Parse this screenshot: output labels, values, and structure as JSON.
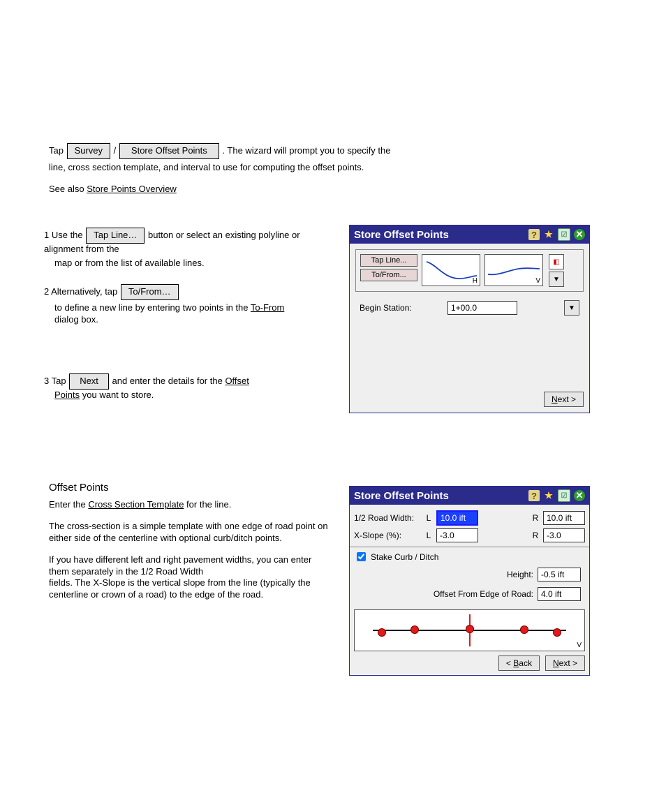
{
  "intro": {
    "line1_pre": "Tap ",
    "btn_survey": "Survey",
    "line1_mid": " / ",
    "btn_store_offset": "Store Offset Points",
    "line1_post": ". The wizard will prompt you to specify the",
    "line2": "line, cross section template, and interval to use for computing the offset points.",
    "line3_pre": "See also ",
    "link_store_points": "Store Points Overview"
  },
  "steps": {
    "s1": {
      "prefix": "1 Use the ",
      "btn": "Tap Line…",
      "suffix": " button or select an existing polyline or alignment from the",
      "cont": "map or from the list of available lines."
    },
    "s2": {
      "prefix": "2 Alternatively, tap ",
      "btn": "To/From…",
      "mid": " to define a new line by entering two points in the ",
      "link": "To-From",
      "cont": "dialog box."
    },
    "s3": {
      "prefix": "3 Tap ",
      "btn": "Next",
      "mid": " and enter the details for the ",
      "link1": "Offset",
      "link2": "Points",
      "cont": " you want to store."
    }
  },
  "dialog1": {
    "title": "Store Offset Points",
    "tap_line": "Tap Line...",
    "to_from": "To/From...",
    "h_label": "H",
    "v_label": "V",
    "begin_station_label": "Begin Station:",
    "begin_station_value": "1+00.0",
    "next": "Next >"
  },
  "offset_heading": "Offset Points",
  "offset_para1_pre": "Enter the ",
  "offset_para1_u": "Cross Section Template",
  "offset_para1_post": " for the line.",
  "offset_para2": "The cross-section is a simple template with one edge of road point on either side of the centerline with optional curb/ditch points.",
  "offset_para3_pre": "If you have different left",
  "offset_para3_rest": " and right pavement widths, you can enter them separately in the 1/2 Road Width",
  "offset_para3_cont": " fields. The X-Slope is the vertical slope from the line (typically the centerline or crown of a road) to the edge of the road.",
  "dialog2": {
    "title": "Store Offset Points",
    "half_road_label": "1/2 Road Width:",
    "L": "L",
    "R": "R",
    "half_road_L": "10.0 ift",
    "half_road_R": "10.0 ift",
    "xslope_label": "X-Slope (%):",
    "xslope_L": "-3.0",
    "xslope_R": "-3.0",
    "stake_curb_label": "Stake Curb / Ditch",
    "height_label": "Height:",
    "height_value": "-0.5 ift",
    "offset_edge_label": "Offset From Edge of Road:",
    "offset_edge_value": "4.0 ift",
    "v_label": "V",
    "back": "< Back",
    "next": "Next >"
  }
}
